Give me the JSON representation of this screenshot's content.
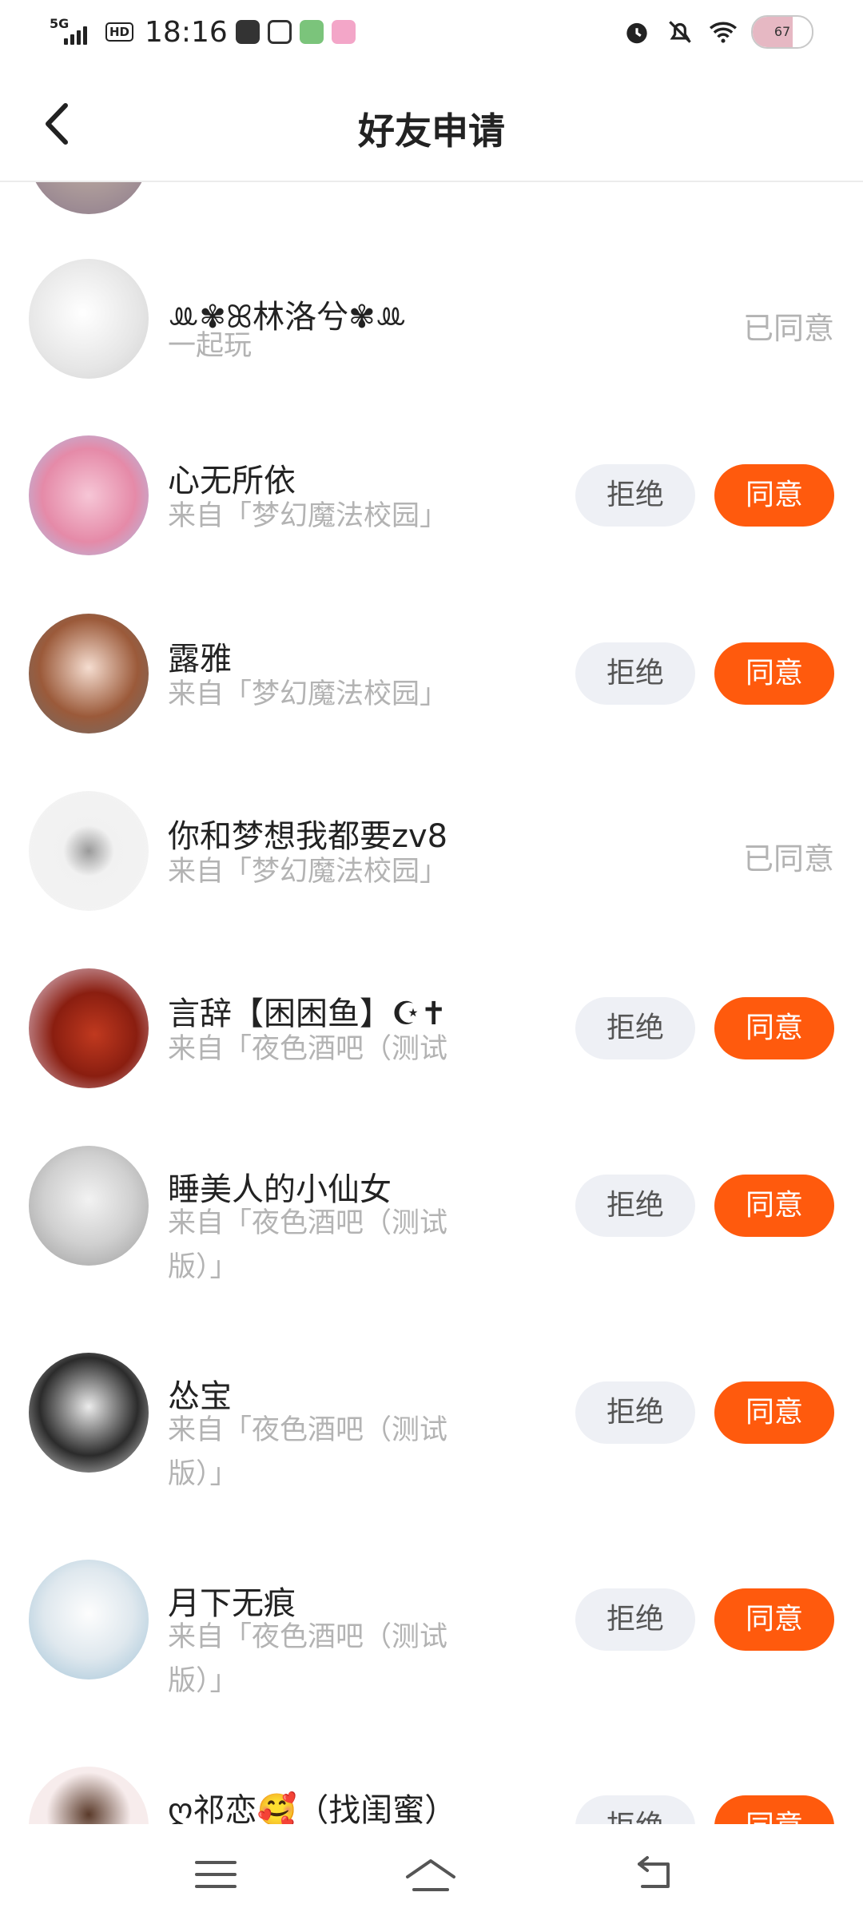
{
  "status_bar": {
    "network": "5G",
    "hd": "HD",
    "time": "18:16",
    "battery_percent": 67
  },
  "header": {
    "back_icon": "chevron-left-icon",
    "title": "好友申请"
  },
  "requests": [
    {
      "name": "𑁍林洛兮𑁍",
      "name_full": "ꔛ✾ꕤ林洛兮✾ꔛ",
      "subtitle": "一起玩",
      "status": "已同意"
    },
    {
      "name": "心无所依",
      "subtitle": "来自「梦幻魔法校园」",
      "reject": "拒绝",
      "accept": "同意"
    },
    {
      "name": "露雅",
      "subtitle": "来自「梦幻魔法校园」",
      "reject": "拒绝",
      "accept": "同意"
    },
    {
      "name": "你和梦想我都要zv8",
      "subtitle": "来自「梦幻魔法校园」",
      "status": "已同意"
    },
    {
      "name": "言辞【困困鱼】☪✝",
      "subtitle": "来自「夜色酒吧（测试",
      "reject": "拒绝",
      "accept": "同意"
    },
    {
      "name": "睡美人的小仙女",
      "subtitle": "来自「夜色酒吧（测试版）」",
      "reject": "拒绝",
      "accept": "同意"
    },
    {
      "name": "怂宝",
      "subtitle": "来自「夜色酒吧（测试版）」",
      "reject": "拒绝",
      "accept": "同意"
    },
    {
      "name": "月下无痕",
      "subtitle": "来自「夜色酒吧（测试版）」",
      "reject": "拒绝",
      "accept": "同意"
    },
    {
      "name": "ღ祁恋🥰（找闺蜜）",
      "reject": "拒绝",
      "accept": "同意"
    }
  ],
  "colors": {
    "accent": "#ff5a0d",
    "reject_bg": "#eef0f5",
    "muted_text": "#b3b3b3"
  },
  "nav_bar": {
    "menu_icon": "menu-icon",
    "home_icon": "home-icon",
    "back_icon": "back-icon"
  }
}
